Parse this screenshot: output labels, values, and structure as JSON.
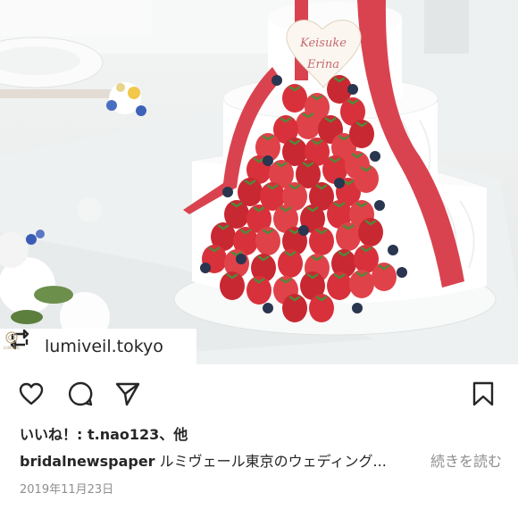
{
  "photo": {
    "alt_subject": "wedding-cake-photo",
    "topper_line1": "Keisuke",
    "topper_line2": "Erina",
    "ribbon_color": "#d9434f",
    "cake_color": "#ffffff"
  },
  "repost": {
    "username": "lumiveil.tokyo",
    "logo_text": "LUMIVEIL"
  },
  "actions": {
    "like_icon": "heart-icon",
    "comment_icon": "comment-icon",
    "share_icon": "share-icon",
    "save_icon": "bookmark-icon"
  },
  "likes_text": "いいね！: t.nao123、他",
  "caption": {
    "username": "bridalnewspaper",
    "text": " ルミヴェール東京のウェディング...",
    "more_label": "続きを読む"
  },
  "date": "2019年11月23日"
}
